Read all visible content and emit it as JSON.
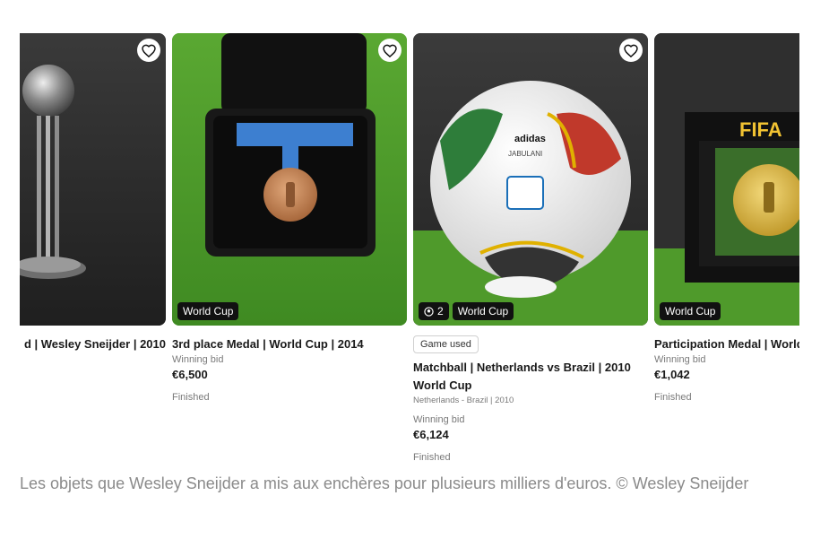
{
  "cards": [
    {
      "title": "d | Wesley Sneijder | 2010",
      "tag": ""
    },
    {
      "title": "3rd place Medal | World Cup | 2014",
      "tag": "World Cup",
      "bid_label": "Winning bid",
      "price": "€6,500",
      "status": "Finished"
    },
    {
      "badge": "Game used",
      "title": "Matchball | Netherlands vs Brazil | 2010 World Cup",
      "subtitle": "Netherlands - Brazil  |  2010",
      "count": "2",
      "tag": "World Cup",
      "bid_label": "Winning bid",
      "price": "€6,124",
      "status": "Finished",
      "ball_brand": "adidas",
      "ball_name": "JABULANI"
    },
    {
      "title": "Participation Medal | World Cup",
      "tag": "World Cup",
      "bid_label": "Winning bid",
      "price": "€1,042",
      "status": "Finished",
      "frame_text": "FIFA"
    }
  ],
  "caption": "Les objets que Wesley Sneijder a mis aux enchères pour plusieurs milliers d'euros. © Wesley Sneijder",
  "colors": {
    "tag_bg": "#111111",
    "grass": "#4f9a2b",
    "muted_text": "#7a7a7a"
  },
  "icons": [
    "heart-icon",
    "ball-count-icon"
  ]
}
